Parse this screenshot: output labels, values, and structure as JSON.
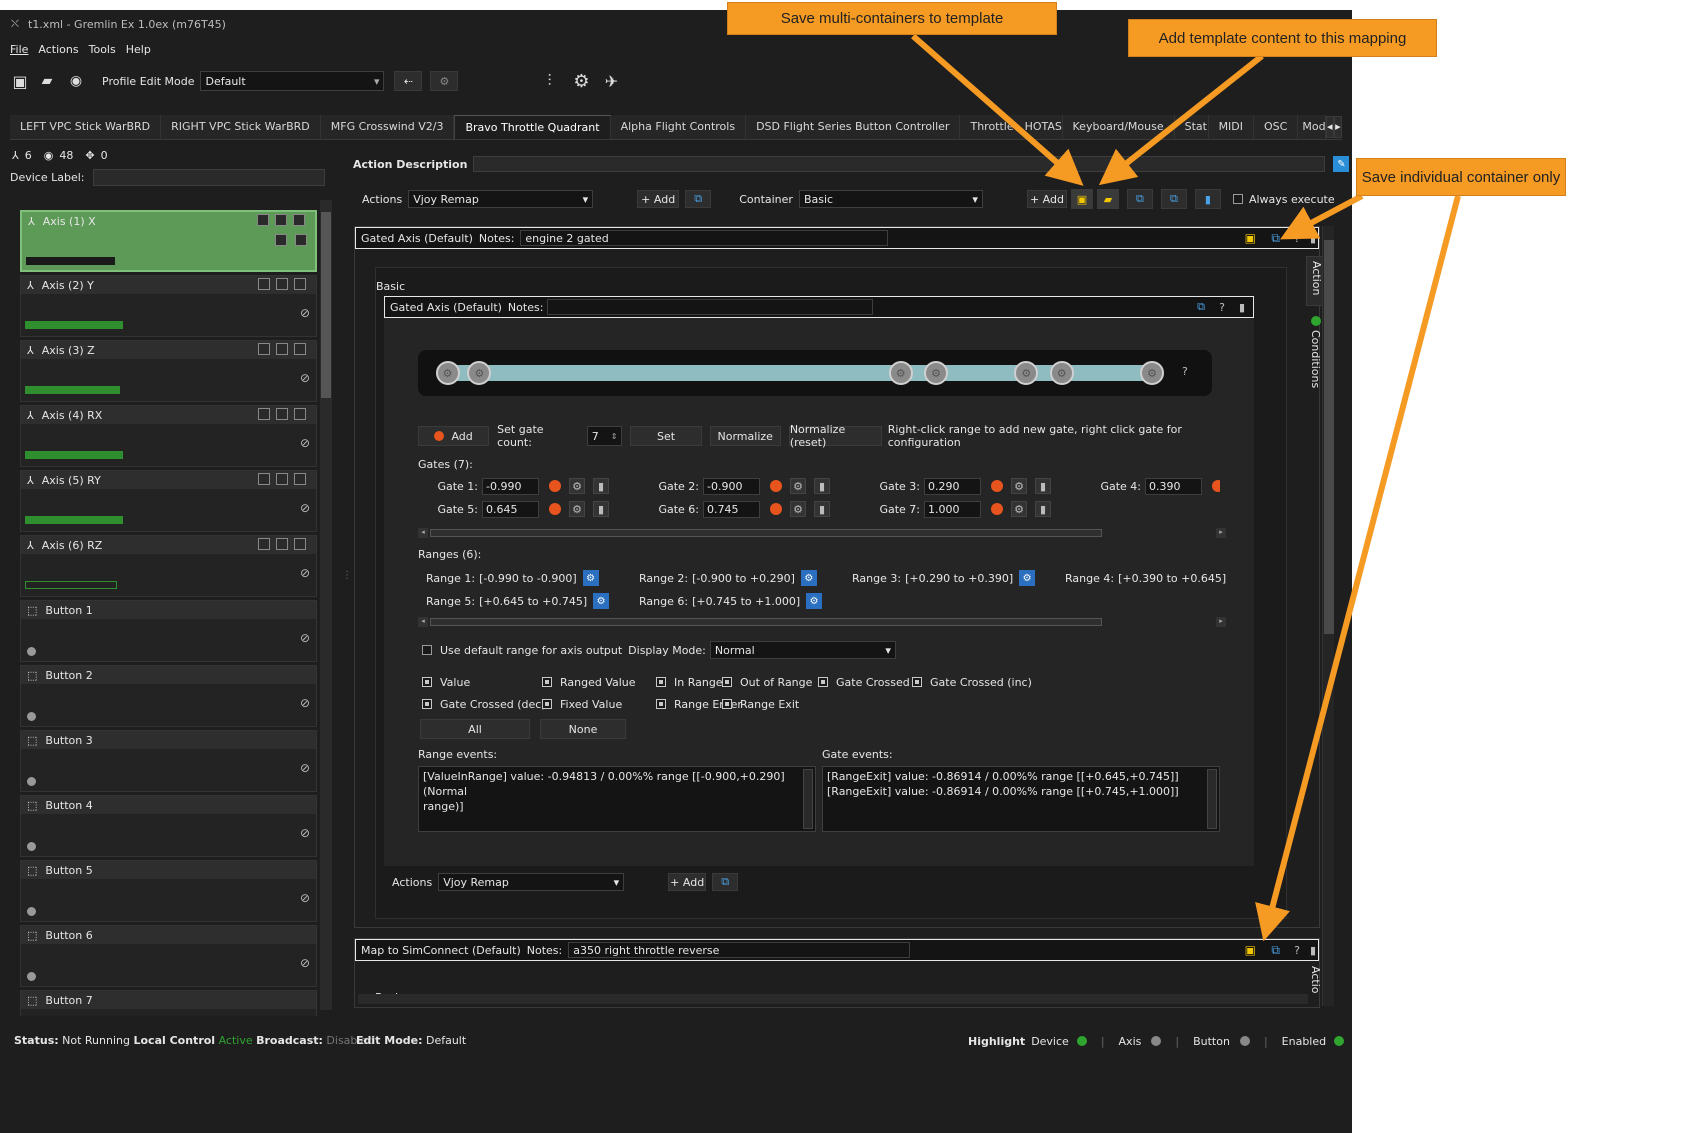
{
  "window": {
    "title": "t1.xml - Gremlin Ex 1.0ex (m76T45)"
  },
  "menu": [
    "File",
    "Actions",
    "Tools",
    "Help"
  ],
  "toolbar": {
    "profile_label": "Profile Edit Mode",
    "profile_value": "Default"
  },
  "tabs": [
    "LEFT VPC Stick WarBRD",
    "RIGHT VPC Stick WarBRD",
    "MFG Crosswind V2/3",
    "Bravo Throttle Quadrant",
    "Alpha Flight Controls",
    "DSD Flight Series Button Controller",
    "Throttle - HOTAS Warthog",
    "Keyboard/Mouse",
    "Stat",
    "MIDI",
    "OSC",
    "Mode"
  ],
  "active_tab": "Bravo Throttle Quadrant",
  "device_counts": {
    "axes": "6",
    "buttons": "48",
    "hats": "0"
  },
  "device_label": "Device Label:",
  "inputs": [
    {
      "label": "Axis (1) X",
      "fill": 0.3
    },
    {
      "label": "Axis (2) Y",
      "fill": 0.33
    },
    {
      "label": "Axis (3) Z",
      "fill": 0.32
    },
    {
      "label": "Axis (4) RX",
      "fill": 0.33
    },
    {
      "label": "Axis (5) RY",
      "fill": 0.33
    },
    {
      "label": "Axis (6) RZ",
      "fill": 0.0
    },
    {
      "label": "Button 1"
    },
    {
      "label": "Button 2"
    },
    {
      "label": "Button 3"
    },
    {
      "label": "Button 4"
    },
    {
      "label": "Button 5"
    },
    {
      "label": "Button 6"
    },
    {
      "label": "Button 7"
    }
  ],
  "action_description": "Action Description",
  "actions_row": {
    "actions_label": "Actions",
    "actions_value": "Vjoy Remap",
    "add": "Add",
    "container_label": "Container",
    "container_value": "Basic",
    "add2": "Add",
    "always_execute": "Always execute"
  },
  "container1": {
    "title": "Gated Axis (Default)",
    "notes_label": "Notes:",
    "notes": "engine 2 gated",
    "basic": "Basic"
  },
  "inner": {
    "title": "Gated Axis (Default)",
    "notes_label": "Notes:"
  },
  "gate_controls": {
    "add": "Add",
    "count_label": "Set gate count:",
    "count": "7",
    "set": "Set",
    "normalize": "Normalize",
    "normalize_reset": "Normalize (reset)",
    "hint": "Right-click range to add new gate, right click gate for configuration"
  },
  "gates_title": "Gates (7):",
  "gates": [
    {
      "label": "Gate 1:",
      "value": "-0.990"
    },
    {
      "label": "Gate 2:",
      "value": "-0.900"
    },
    {
      "label": "Gate 3:",
      "value": "0.290"
    },
    {
      "label": "Gate 4:",
      "value": "0.390"
    },
    {
      "label": "Gate 5:",
      "value": "0.645"
    },
    {
      "label": "Gate 6:",
      "value": "0.745"
    },
    {
      "label": "Gate 7:",
      "value": "1.000"
    }
  ],
  "ranges_title": "Ranges (6):",
  "ranges": [
    {
      "label": "Range 1:",
      "value": "[-0.990 to -0.900]"
    },
    {
      "label": "Range 2:",
      "value": "[-0.900 to +0.290]"
    },
    {
      "label": "Range 3:",
      "value": "[+0.290 to +0.390]"
    },
    {
      "label": "Range 4:",
      "value": "[+0.390 to +0.645]"
    },
    {
      "label": "Range 5:",
      "value": "[+0.645 to +0.745]"
    },
    {
      "label": "Range 6:",
      "value": "[+0.745 to +1.000]"
    }
  ],
  "default_range": "Use default range for axis output",
  "display_mode": {
    "label": "Display Mode:",
    "value": "Normal"
  },
  "event_filters": [
    "Value",
    "Ranged Value",
    "In Range",
    "Out of Range",
    "Gate Crossed",
    "Gate Crossed (inc)",
    "Gate Crossed (dec)",
    "Fixed Value",
    "Range Enter",
    "Range Exit"
  ],
  "all_btn": "All",
  "none_btn": "None",
  "range_events": {
    "label": "Range events:",
    "lines": [
      "[ValueInRange] value: -0.94813 / 0.00%% range [[-0.900,+0.290] (Normal",
      "range)]"
    ]
  },
  "gate_events": {
    "label": "Gate events:",
    "lines": [
      "[RangeExit] value: -0.86914 / 0.00%% range [[+0.645,+0.745]]",
      "[RangeExit] value: -0.86914 / 0.00%% range [[+0.745,+1.000]]"
    ]
  },
  "inner_actions": {
    "label": "Actions",
    "value": "Vjoy Remap",
    "add": "Add"
  },
  "container2": {
    "title": "Map to SimConnect (Default)",
    "notes_label": "Notes:",
    "notes": "a350 right throttle reverse",
    "basic": "Basic"
  },
  "side_tabs": {
    "action": "Action",
    "conditions": "Conditions",
    "action2": "Actio"
  },
  "status": {
    "status_label": "Status:",
    "status_value": "Not Running",
    "local": "Local Control",
    "active": "Active",
    "broadcast": "Broadcast:",
    "disabled": "Disabled",
    "edit_mode": "Edit Mode:",
    "edit_value": "Default",
    "highlight": "Highlight",
    "device": "Device",
    "axis": "Axis",
    "button": "Button",
    "enabled": "Enabled"
  },
  "annotations": {
    "a1": "Save multi-containers to template",
    "a2": "Add template content to this mapping",
    "a3": "Save individual container only"
  },
  "colors": {
    "accent_orange": "#f59a23",
    "green_active": "#2fa52f",
    "record_red": "#e8541d"
  }
}
